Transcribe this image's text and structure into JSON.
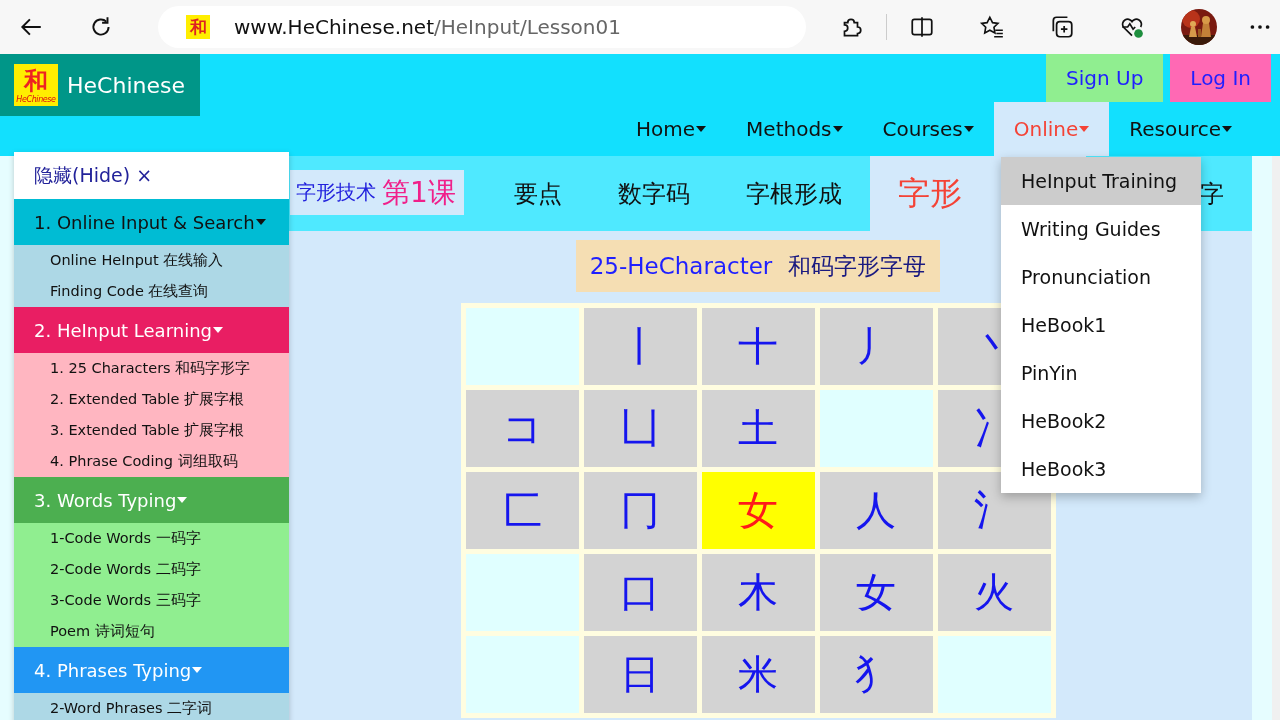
{
  "browser": {
    "favicon_text": "和",
    "url_host": "www.HeChinese.net",
    "url_path": "/HeInput/Lesson01"
  },
  "logo": {
    "mark": "和",
    "mark_caption": "HeChinese",
    "name": "HeChinese"
  },
  "auth": [
    {
      "label": "Sign Up",
      "color": "#90ee90"
    },
    {
      "label": "Log In",
      "color": "#ff69b4"
    }
  ],
  "nav": [
    {
      "label": "Home",
      "selected": false
    },
    {
      "label": "Methods",
      "selected": false
    },
    {
      "label": "Courses",
      "selected": false
    },
    {
      "label": "Online",
      "selected": true
    },
    {
      "label": "Resource",
      "selected": false
    }
  ],
  "online_menu": [
    {
      "label": "HeInput Training",
      "selected": true
    },
    {
      "label": "Writing Guides",
      "selected": false
    },
    {
      "label": "Pronunciation",
      "selected": false
    },
    {
      "label": "HeBook1",
      "selected": false
    },
    {
      "label": "PinYin",
      "selected": false
    },
    {
      "label": "HeBook2",
      "selected": false
    },
    {
      "label": "HeBook3",
      "selected": false
    }
  ],
  "sidebar": {
    "hide_label": "隐藏(Hide) ×",
    "sections": [
      {
        "title": "1. Online Input & Search",
        "color": "#00bcd4",
        "items": [
          "Online HeInput 在线输入",
          "Finding Code 在线查询"
        ]
      },
      {
        "title": "2. HeInput Learning",
        "color": "#e91e63",
        "items": [
          "1. 25 Characters 和码字形字",
          "2. Extended Table 扩展字根",
          "3. Extended Table 扩展字根",
          "4. Phrase Coding 词组取码"
        ]
      },
      {
        "title": "3. Words Typing",
        "color": "#4caf50",
        "items": [
          "1-Code Words 一码字",
          "2-Code Words 二码字",
          "3-Code Words 三码字",
          "Poem 诗词短句"
        ]
      },
      {
        "title": "4. Phrases Typing",
        "color": "#2196f3",
        "items": [
          "2-Word Phrases 二字词"
        ]
      }
    ]
  },
  "lesson": {
    "prefix": "字形技术",
    "number": "第1课"
  },
  "tabs": [
    {
      "label": "要点",
      "selected": false
    },
    {
      "label": "数字码",
      "selected": false
    },
    {
      "label": "字根形成",
      "selected": false
    },
    {
      "label": "字形",
      "selected": true
    },
    {
      "label": "字",
      "selected": false
    }
  ],
  "heading": {
    "latin": "25-HeCharacter",
    "chinese": "和码字形字母"
  },
  "grid": [
    [
      {
        "kind": "empty"
      },
      {
        "kind": "char",
        "text": "丨"
      },
      {
        "kind": "char",
        "text": "十"
      },
      {
        "kind": "char",
        "text": "丿"
      },
      {
        "kind": "char",
        "text": "丶"
      }
    ],
    [
      {
        "kind": "char",
        "text": "コ"
      },
      {
        "kind": "char",
        "text": "凵"
      },
      {
        "kind": "char",
        "text": "土"
      },
      {
        "kind": "empty"
      },
      {
        "kind": "char",
        "text": "冫"
      }
    ],
    [
      {
        "kind": "char",
        "text": "匚"
      },
      {
        "kind": "char",
        "text": "冂"
      },
      {
        "kind": "highlight",
        "text": "女"
      },
      {
        "kind": "char",
        "text": "人"
      },
      {
        "kind": "char",
        "text": "氵"
      }
    ],
    [
      {
        "kind": "empty"
      },
      {
        "kind": "char",
        "text": "口"
      },
      {
        "kind": "char",
        "text": "木"
      },
      {
        "kind": "char",
        "text": "女"
      },
      {
        "kind": "char",
        "text": "火"
      }
    ],
    [
      {
        "kind": "empty"
      },
      {
        "kind": "char",
        "text": "日"
      },
      {
        "kind": "char",
        "text": "米"
      },
      {
        "kind": "char",
        "text": "犭"
      },
      {
        "kind": "empty"
      }
    ]
  ]
}
